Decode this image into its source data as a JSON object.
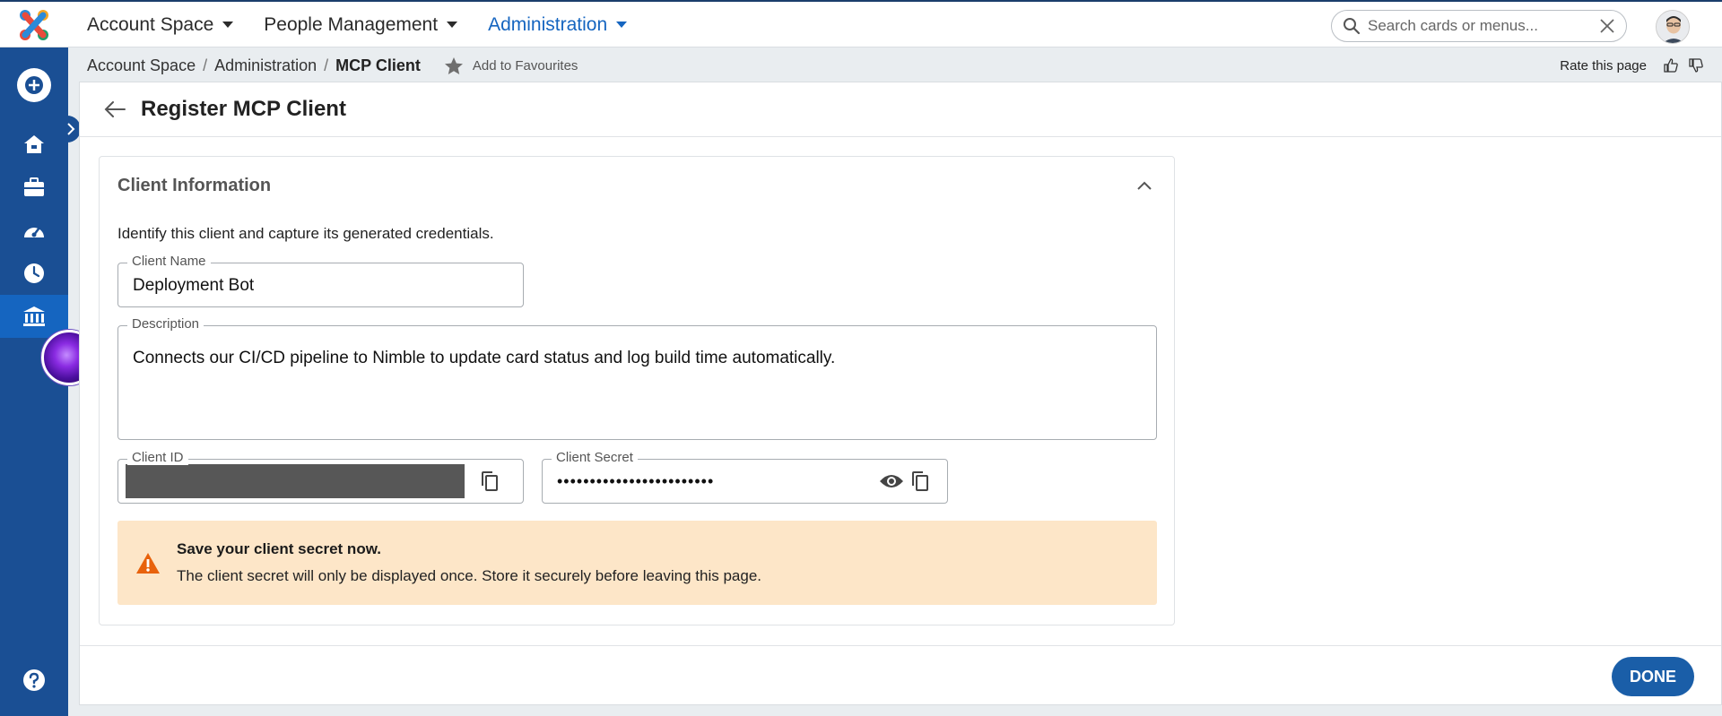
{
  "header": {
    "nav": [
      {
        "label": "Account Space"
      },
      {
        "label": "People Management"
      },
      {
        "label": "Administration"
      }
    ],
    "search_placeholder": "Search cards or menus..."
  },
  "breadcrumb": {
    "items": [
      "Account Space",
      "Administration"
    ],
    "current": "MCP Client",
    "favourites_label": "Add to Favourites"
  },
  "rate": {
    "label": "Rate this page"
  },
  "page": {
    "title": "Register MCP Client"
  },
  "card": {
    "title": "Client Information",
    "description": "Identify this client and capture its generated credentials.",
    "fields": {
      "client_name": {
        "label": "Client Name",
        "value": "Deployment Bot"
      },
      "description": {
        "label": "Description",
        "value": "Connects our CI/CD pipeline to Nimble to update card status and log build time automatically."
      },
      "client_id": {
        "label": "Client ID"
      },
      "client_secret": {
        "label": "Client Secret",
        "masked": "••••••••••••••••••••••••"
      }
    },
    "alert": {
      "title": "Save your client secret now.",
      "body": "The client secret will only be displayed once. Store it securely before leaving this page."
    }
  },
  "footer": {
    "done_label": "DONE"
  },
  "colors": {
    "sidebar": "#1a4f94",
    "accent": "#1565c0",
    "warning_bg": "#fde6c8",
    "warning_icon": "#e8620c"
  }
}
